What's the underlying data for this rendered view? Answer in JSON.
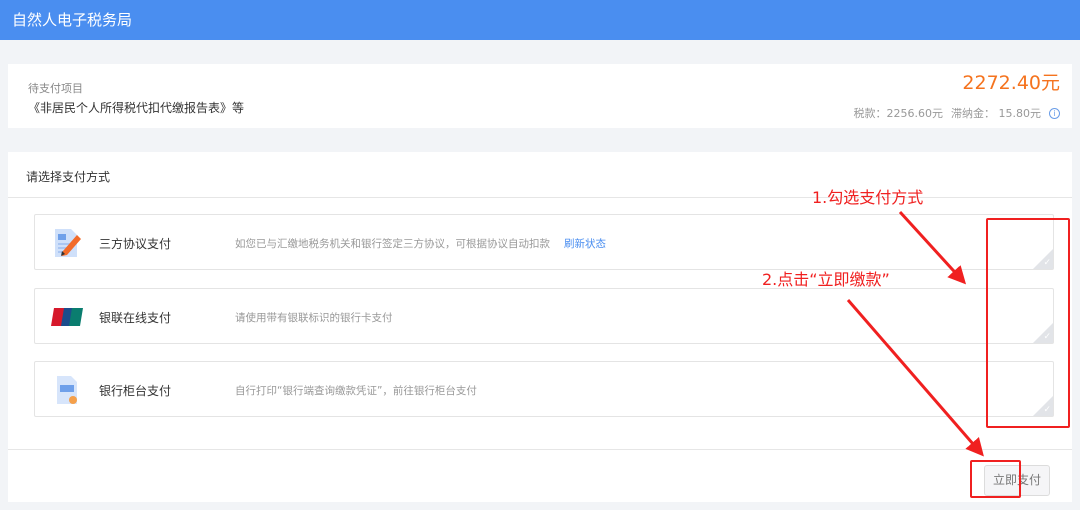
{
  "header": {
    "title": "自然人电子税务局"
  },
  "pending": {
    "label": "待支付项目",
    "project": "《非居民个人所得税代扣代缴报告表》等",
    "total": "2272.40元",
    "tax": "税款：2256.60元",
    "late_fee": "滞纳金： 15.80元"
  },
  "payment": {
    "title": "请选择支付方式",
    "options": [
      {
        "name": "三方协议支付",
        "desc": "如您已与汇缴地税务机关和银行签定三方协议，可根据协议自动扣款",
        "link": "刷新状态"
      },
      {
        "name": "银联在线支付",
        "desc": "请使用带有银联标识的银行卡支付"
      },
      {
        "name": "银行柜台支付",
        "desc": "自行打印“银行端查询缴款凭证”，前往银行柜台支付"
      }
    ],
    "submit": "立即支付"
  },
  "annotations": {
    "step1": "1.勾选支付方式",
    "step2": "2.点击“立即缴款”"
  },
  "colors": {
    "header": "#4a8ef0",
    "amount": "#f5731e",
    "annotation": "#f02020"
  }
}
